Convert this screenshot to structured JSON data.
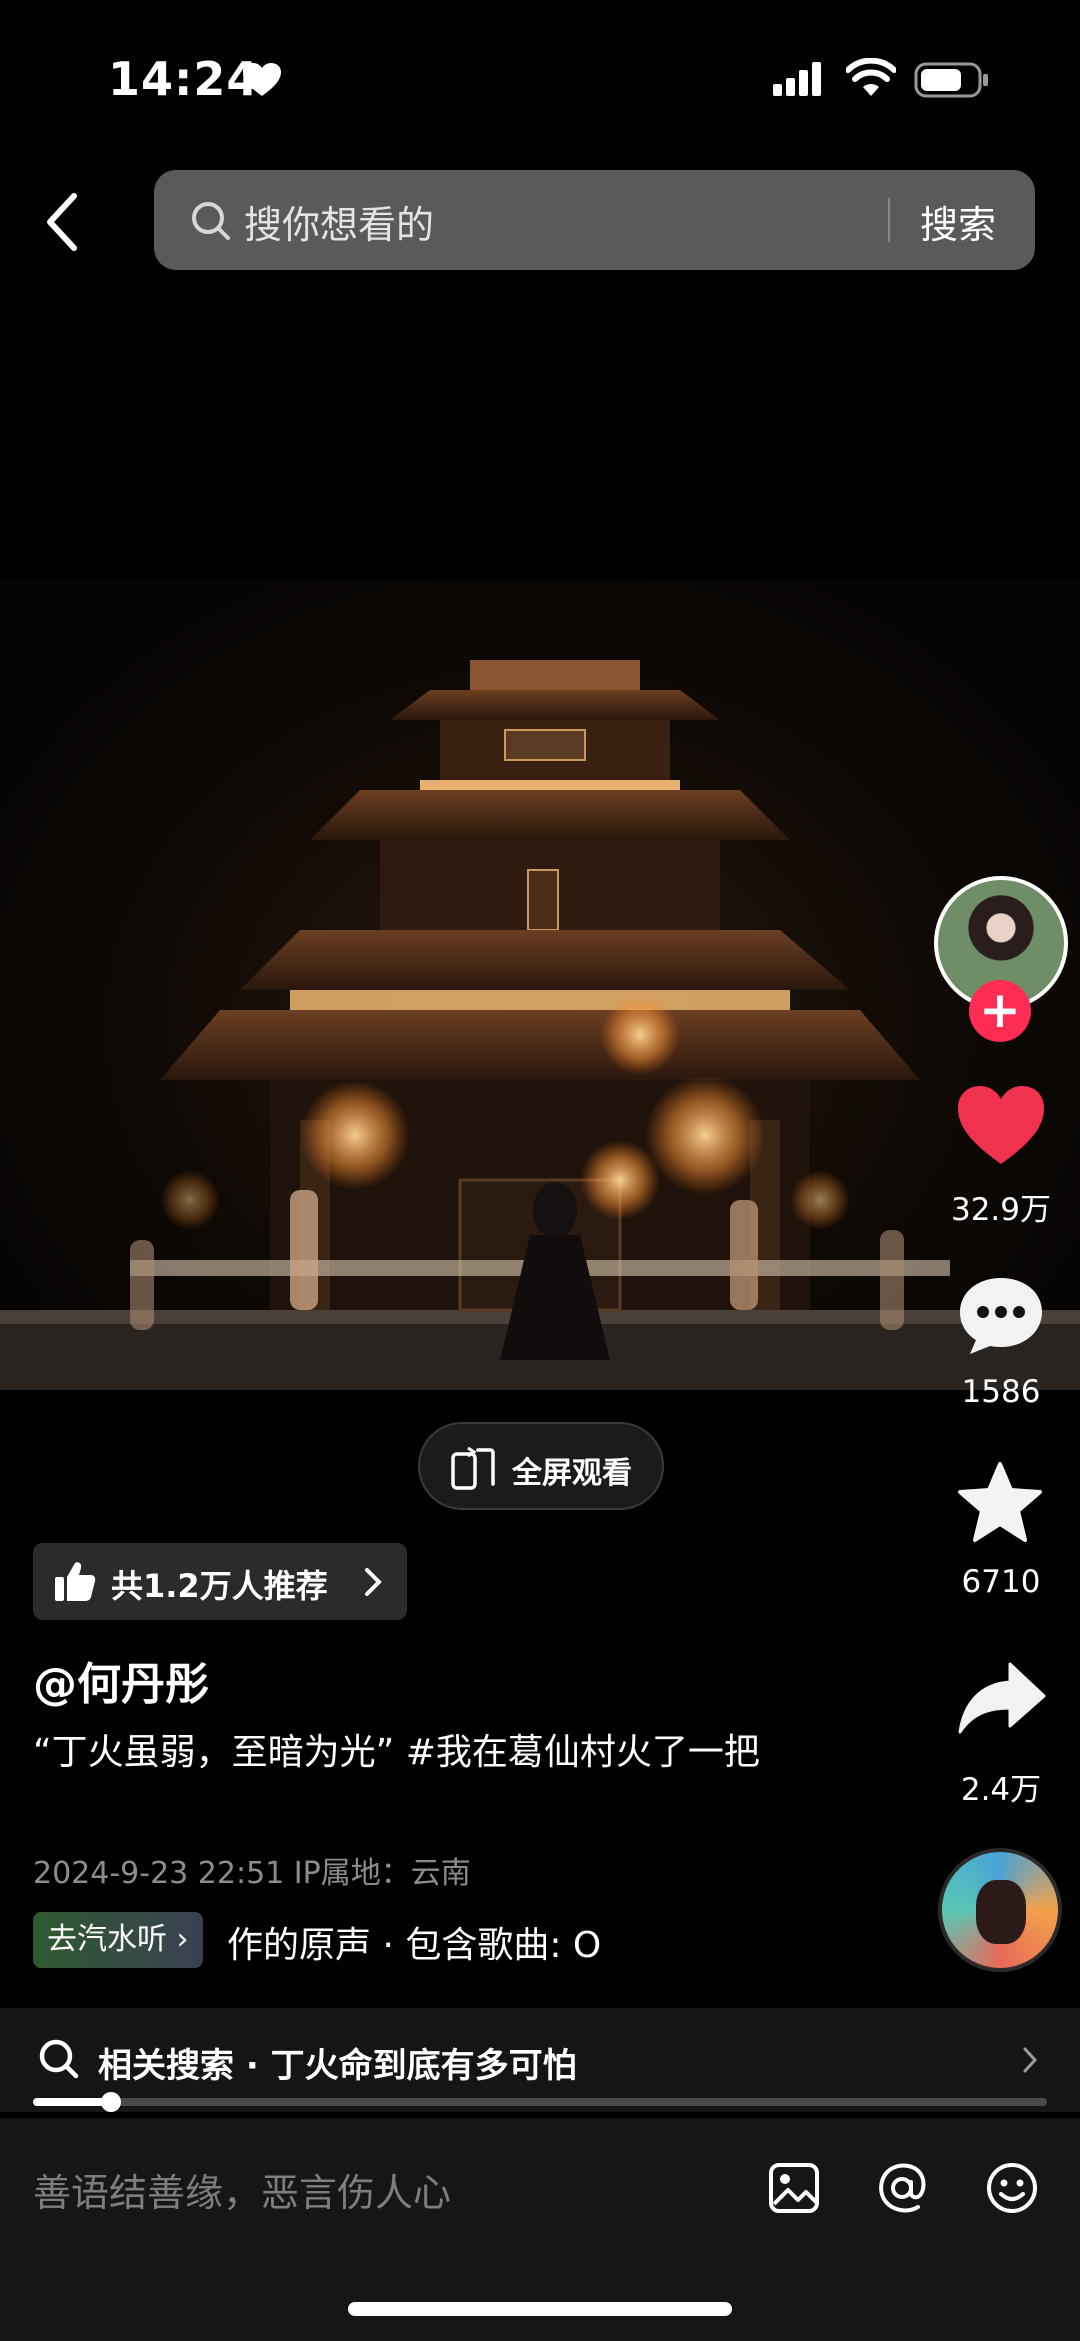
{
  "status_bar": {
    "time": "14:24",
    "heart_icon": "heart-icon",
    "signal_icon": "signal-icon",
    "wifi_icon": "wifi-icon",
    "battery_icon": "battery-icon"
  },
  "search": {
    "placeholder": "搜你想看的",
    "submit_label": "搜索"
  },
  "video": {
    "fullscreen_label": "全屏观看"
  },
  "actions": {
    "likes": "32.9万",
    "comments": "1586",
    "favorites": "6710",
    "shares": "2.4万",
    "follow_label": "+"
  },
  "recommend": {
    "label": "共1.2万人推荐"
  },
  "post": {
    "author": "@何丹彤",
    "caption": "“丁火虽弱，至暗为光” #我在葛仙村火了一把",
    "meta": "2024-9-23 22:51  IP属地：云南",
    "music_chip": "去汽水听",
    "music_text": "作的原声 · 包含歌曲: O"
  },
  "related_search": {
    "label": "相关搜索 · 丁火命到底有多可怕"
  },
  "progress": {
    "fraction": 0.077
  },
  "comment_bar": {
    "placeholder": "善语结善缘，恶言伤人心"
  },
  "colors": {
    "accent_red": "#fe2c55",
    "like_red": "#f0324f"
  }
}
